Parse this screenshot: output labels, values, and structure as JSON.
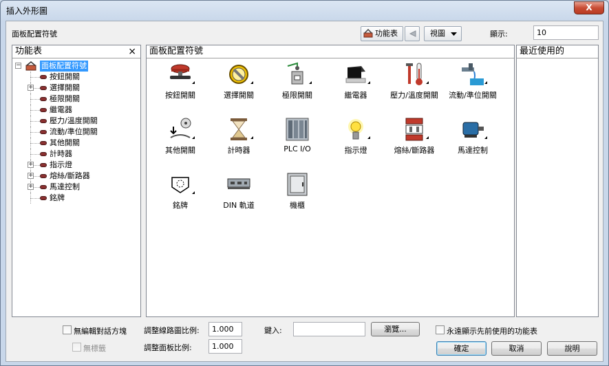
{
  "window": {
    "title": "插入外形圖",
    "close_label": "X"
  },
  "toolbar": {
    "section_label": "面板配置符號",
    "menu_button_label": "功能表",
    "view_label": "視圖",
    "display_label": "顯示:",
    "display_value": "10"
  },
  "menu_panel": {
    "title": "功能表",
    "close_label": "×",
    "root": "面板配置符號",
    "items": [
      {
        "label": "按鈕開關",
        "expandable": false
      },
      {
        "label": "選擇開關",
        "expandable": true
      },
      {
        "label": "極限開關",
        "expandable": false
      },
      {
        "label": "繼電器",
        "expandable": false
      },
      {
        "label": "壓力/溫度開關",
        "expandable": false
      },
      {
        "label": "流動/準位開關",
        "expandable": false
      },
      {
        "label": "其他開關",
        "expandable": false
      },
      {
        "label": "計時器",
        "expandable": false
      },
      {
        "label": "指示燈",
        "expandable": true
      },
      {
        "label": "熔絲/斷路器",
        "expandable": true
      },
      {
        "label": "馬達控制",
        "expandable": true
      },
      {
        "label": "銘牌",
        "expandable": false
      }
    ]
  },
  "symbols_panel": {
    "title": "面板配置符號",
    "items": [
      {
        "label": "按鈕開關",
        "icon": "pushbutton-icon",
        "submenu": true
      },
      {
        "label": "選擇開關",
        "icon": "selector-switch-icon",
        "submenu": true
      },
      {
        "label": "極限開關",
        "icon": "limit-switch-icon",
        "submenu": true
      },
      {
        "label": "繼電器",
        "icon": "relay-icon",
        "submenu": true
      },
      {
        "label": "壓力/溫度開關",
        "icon": "pressure-temperature-icon",
        "submenu": true
      },
      {
        "label": "流動/準位開關",
        "icon": "flow-level-icon",
        "submenu": true
      },
      {
        "label": "其他開關",
        "icon": "other-switch-icon",
        "submenu": true
      },
      {
        "label": "計時器",
        "icon": "timer-icon",
        "submenu": true
      },
      {
        "label": "PLC I/O",
        "icon": "plc-io-icon",
        "submenu": false
      },
      {
        "label": "指示燈",
        "icon": "pilot-light-icon",
        "submenu": true
      },
      {
        "label": "熔絲/斷路器",
        "icon": "fuse-breaker-icon",
        "submenu": true
      },
      {
        "label": "馬達控制",
        "icon": "motor-control-icon",
        "submenu": true
      },
      {
        "label": "銘牌",
        "icon": "nameplate-icon",
        "submenu": true
      },
      {
        "label": "DIN 軌道",
        "icon": "din-rail-icon",
        "submenu": false
      },
      {
        "label": "機櫃",
        "icon": "enclosure-icon",
        "submenu": false
      }
    ]
  },
  "recent_panel": {
    "title": "最近使用的"
  },
  "options": {
    "no_edit_dialog": "無編輯對話方塊",
    "no_tag": "無標籤",
    "wire_scale_label": "調整線路圖比例:",
    "wire_scale_value": "1.000",
    "panel_scale_label": "調整面板比例:",
    "panel_scale_value": "1.000",
    "type_label": "鍵入:",
    "type_value": "",
    "browse_label": "瀏覽...",
    "always_show_recent": "永遠顯示先前使用的功能表"
  },
  "buttons": {
    "ok": "確定",
    "cancel": "取消",
    "help": "說明"
  }
}
